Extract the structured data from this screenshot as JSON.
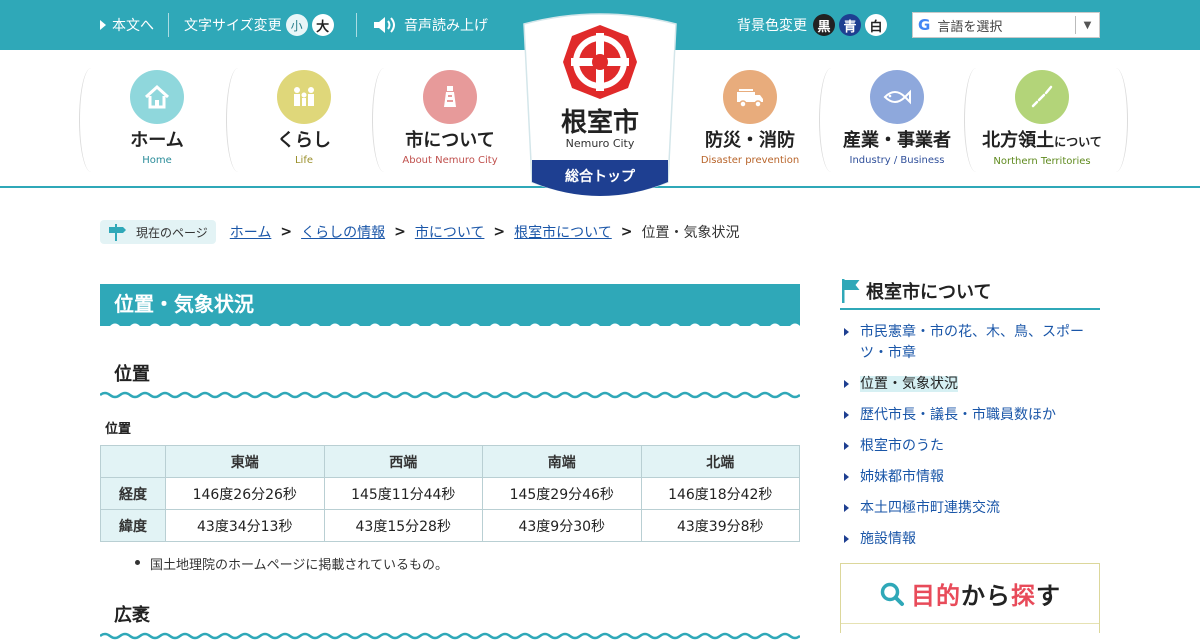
{
  "topbar": {
    "skip_link": "本文へ",
    "font_size_label": "文字サイズ変更",
    "font_small": "小",
    "font_large": "大",
    "speech_label": "音声読み上げ",
    "bg_color_label": "背景色変更",
    "bg_black": "黒",
    "bg_blue": "青",
    "bg_white": "白",
    "language_select": "言語を選択",
    "google_mark": "G"
  },
  "nav": {
    "items": [
      {
        "label": "ホーム",
        "sub": "Home",
        "color": "#8fd7dc"
      },
      {
        "label": "くらし",
        "sub": "Life",
        "color": "#dfd77a"
      },
      {
        "label": "市について",
        "sub": "About Nemuro City",
        "color": "#e79a9a"
      },
      {
        "label": "防災・消防",
        "sub": "Disaster prevention",
        "color": "#e8ac7c"
      },
      {
        "label": "産業・事業者",
        "sub": "Industry / Business",
        "color": "#8ea8dc"
      },
      {
        "label": "北方領土",
        "label_suffix": "について",
        "sub": "Northern Territories",
        "color": "#b3d479"
      }
    ]
  },
  "logo": {
    "city_name": "根室市",
    "city_name_en": "Nemuro City",
    "top_link": "総合トップ",
    "emblem_color": "#e02a2a",
    "band_color": "#1e3f91"
  },
  "breadcrumb": {
    "badge": "現在のページ",
    "links": [
      "ホーム",
      "くらしの情報",
      "市について",
      "根室市について"
    ],
    "separator": ">",
    "current": "位置・気象状況"
  },
  "main": {
    "title": "位置・気象状況",
    "section1_heading": "位置",
    "table_caption": "位置",
    "table": {
      "columns": [
        "東端",
        "西端",
        "南端",
        "北端"
      ],
      "rows": [
        {
          "label": "経度",
          "cells": [
            "146度26分26秒",
            "145度11分44秒",
            "145度29分46秒",
            "146度18分42秒"
          ]
        },
        {
          "label": "緯度",
          "cells": [
            "43度34分13秒",
            "43度15分28秒",
            "43度9分30秒",
            "43度39分8秒"
          ]
        }
      ]
    },
    "note": "国土地理院のホームページに掲載されているもの。",
    "section2_heading": "広袤"
  },
  "sidebar": {
    "title": "根室市について",
    "items": [
      "市民憲章・市の花、木、鳥、スポーツ・市章",
      "位置・気象状況",
      "歴代市長・議長・市職員数ほか",
      "根室市のうた",
      "姉妹都市情報",
      "本土四極市町連携交流",
      "施設情報"
    ],
    "purpose": {
      "w1": "目的",
      "w2": "から",
      "w3": "探",
      "w4": "す"
    }
  },
  "colors": {
    "teal": "#2fa8b8",
    "navy": "#1e3f91",
    "link": "#1a56a8"
  }
}
